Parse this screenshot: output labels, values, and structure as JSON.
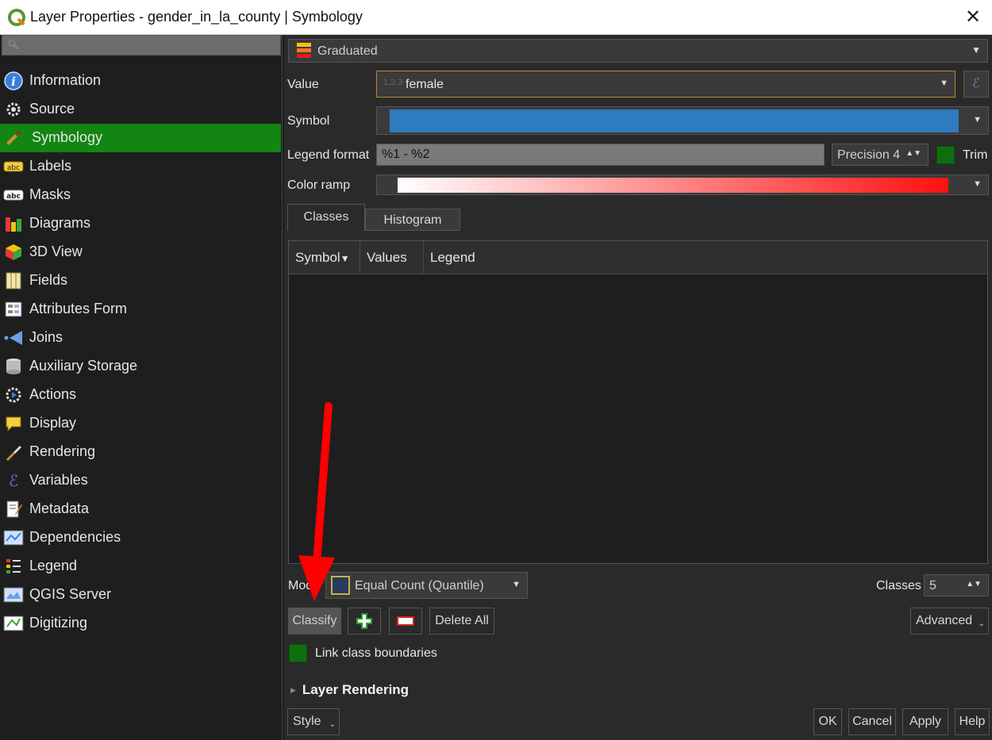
{
  "window": {
    "title": "Layer Properties - gender_in_la_county | Symbology",
    "close_glyph": "✕"
  },
  "sidebar": {
    "search_placeholder": "",
    "items": [
      {
        "label": "Information",
        "icon": "information-icon"
      },
      {
        "label": "Source",
        "icon": "source-icon"
      },
      {
        "label": "Symbology",
        "icon": "symbology-icon",
        "active": true
      },
      {
        "label": "Labels",
        "icon": "labels-icon"
      },
      {
        "label": "Masks",
        "icon": "masks-icon"
      },
      {
        "label": "Diagrams",
        "icon": "diagrams-icon"
      },
      {
        "label": "3D View",
        "icon": "3d-view-icon"
      },
      {
        "label": "Fields",
        "icon": "fields-icon"
      },
      {
        "label": "Attributes Form",
        "icon": "attributes-form-icon"
      },
      {
        "label": "Joins",
        "icon": "joins-icon"
      },
      {
        "label": "Auxiliary Storage",
        "icon": "auxiliary-storage-icon"
      },
      {
        "label": "Actions",
        "icon": "actions-icon"
      },
      {
        "label": "Display",
        "icon": "display-icon"
      },
      {
        "label": "Rendering",
        "icon": "rendering-icon"
      },
      {
        "label": "Variables",
        "icon": "variables-icon"
      },
      {
        "label": "Metadata",
        "icon": "metadata-icon"
      },
      {
        "label": "Dependencies",
        "icon": "dependencies-icon"
      },
      {
        "label": "Legend",
        "icon": "legend-icon"
      },
      {
        "label": "QGIS Server",
        "icon": "qgis-server-icon"
      },
      {
        "label": "Digitizing",
        "icon": "digitizing-icon"
      }
    ]
  },
  "symbology": {
    "renderer": "Graduated",
    "value_label": "Value",
    "value_field_type": "1.2.3",
    "value_field": "female",
    "symbol_label": "Symbol",
    "symbol_color": "#2f7bbf",
    "legend_format_label": "Legend format",
    "legend_format": "%1 - %2",
    "precision": "Precision 4",
    "trim_label": "Trim",
    "trim_checked": true,
    "color_ramp_label": "Color ramp",
    "color_ramp": [
      "#ffffff",
      "#ff1111"
    ]
  },
  "tabs": [
    {
      "label": "Classes",
      "active": true
    },
    {
      "label": "Histogram",
      "active": false
    }
  ],
  "table": {
    "columns": [
      "Symbol",
      "Values",
      "Legend"
    ],
    "rows": []
  },
  "mode": {
    "label": "Mode",
    "value": "Equal Count (Quantile)"
  },
  "classes": {
    "label": "Classes",
    "value": "5"
  },
  "buttons": {
    "classify": "Classify",
    "delete_all": "Delete All",
    "advanced": "Advanced",
    "style": "Style",
    "ok": "OK",
    "cancel": "Cancel",
    "apply": "Apply",
    "help": "Help"
  },
  "link_boundaries": {
    "label": "Link class boundaries",
    "checked": true
  },
  "layer_rendering": "Layer Rendering",
  "colors": {
    "active_nav": "#138512",
    "checkbox_green": "#0f6e10",
    "annotation_arrow": "#ff0000"
  }
}
